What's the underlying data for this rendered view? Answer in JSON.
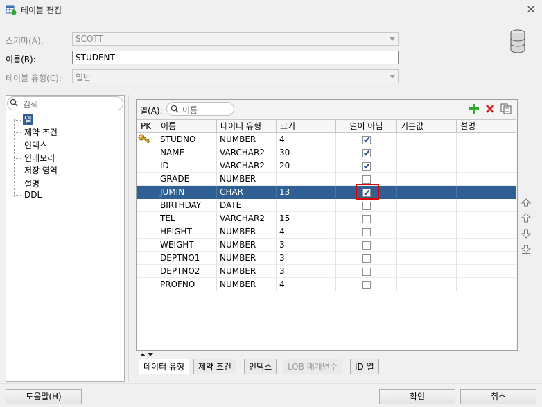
{
  "window": {
    "title": "테이블 편집"
  },
  "form": {
    "schema_label": "스키마(A):",
    "schema_value": "SCOTT",
    "name_label": "이름(B):",
    "name_value": "STUDENT",
    "table_type_label": "테이블 유형(C):",
    "table_type_value": "일반"
  },
  "left_search": {
    "placeholder": "검색"
  },
  "tree": {
    "items": [
      "열",
      "제약 조건",
      "인덱스",
      "인메모리",
      "저장 영역",
      "설명",
      "DDL"
    ],
    "selected": "열"
  },
  "columns_panel": {
    "label": "열(A):",
    "search_placeholder": "이름",
    "headers": [
      "PK",
      "이름",
      "데이터 유형",
      "크기",
      "널이 아님",
      "기본값",
      "설명"
    ],
    "rows": [
      {
        "pk": true,
        "name": "STUDNO",
        "type": "NUMBER",
        "size": "4",
        "not_null": true,
        "default": "",
        "comment": ""
      },
      {
        "pk": false,
        "name": "NAME",
        "type": "VARCHAR2",
        "size": "30",
        "not_null": true,
        "default": "",
        "comment": ""
      },
      {
        "pk": false,
        "name": "ID",
        "type": "VARCHAR2",
        "size": "20",
        "not_null": true,
        "default": "",
        "comment": ""
      },
      {
        "pk": false,
        "name": "GRADE",
        "type": "NUMBER",
        "size": "",
        "not_null": false,
        "default": "",
        "comment": ""
      },
      {
        "pk": false,
        "name": "JUMIN",
        "type": "CHAR",
        "size": "13",
        "not_null": true,
        "default": "",
        "comment": "",
        "selected": true
      },
      {
        "pk": false,
        "name": "BIRTHDAY",
        "type": "DATE",
        "size": "",
        "not_null": false,
        "default": "",
        "comment": ""
      },
      {
        "pk": false,
        "name": "TEL",
        "type": "VARCHAR2",
        "size": "15",
        "not_null": false,
        "default": "",
        "comment": ""
      },
      {
        "pk": false,
        "name": "HEIGHT",
        "type": "NUMBER",
        "size": "4",
        "not_null": false,
        "default": "",
        "comment": ""
      },
      {
        "pk": false,
        "name": "WEIGHT",
        "type": "NUMBER",
        "size": "3",
        "not_null": false,
        "default": "",
        "comment": ""
      },
      {
        "pk": false,
        "name": "DEPTNO1",
        "type": "NUMBER",
        "size": "3",
        "not_null": false,
        "default": "",
        "comment": ""
      },
      {
        "pk": false,
        "name": "DEPTNO2",
        "type": "NUMBER",
        "size": "3",
        "not_null": false,
        "default": "",
        "comment": ""
      },
      {
        "pk": false,
        "name": "PROFNO",
        "type": "NUMBER",
        "size": "4",
        "not_null": false,
        "default": "",
        "comment": ""
      }
    ]
  },
  "tabs": {
    "items": [
      {
        "label": "데이터 유형",
        "state": "active"
      },
      {
        "label": "제약 조건",
        "state": "normal"
      },
      {
        "label": "인덱스",
        "state": "normal"
      },
      {
        "label": "LOB 매개변수",
        "state": "disabled"
      },
      {
        "label": "ID 열",
        "state": "normal"
      }
    ]
  },
  "buttons": {
    "help": "도움말(H)",
    "ok": "확인",
    "cancel": "취소"
  },
  "icons": {
    "title": "table-edit-icon",
    "close": "close-icon",
    "database": "database-icon",
    "search": "search-icon",
    "add": "add-icon",
    "delete": "delete-icon",
    "copy": "copy-icon",
    "primary_key": "key-icon",
    "move_top": "move-top-icon",
    "move_up": "move-up-icon",
    "move_down": "move-down-icon",
    "move_bottom": "move-bottom-icon"
  },
  "colors": {
    "selection": "#2f5f93",
    "highlight_box": "#e00000",
    "add": "#2eaa2e",
    "delete": "#d42020",
    "key": "#d8a32a"
  }
}
